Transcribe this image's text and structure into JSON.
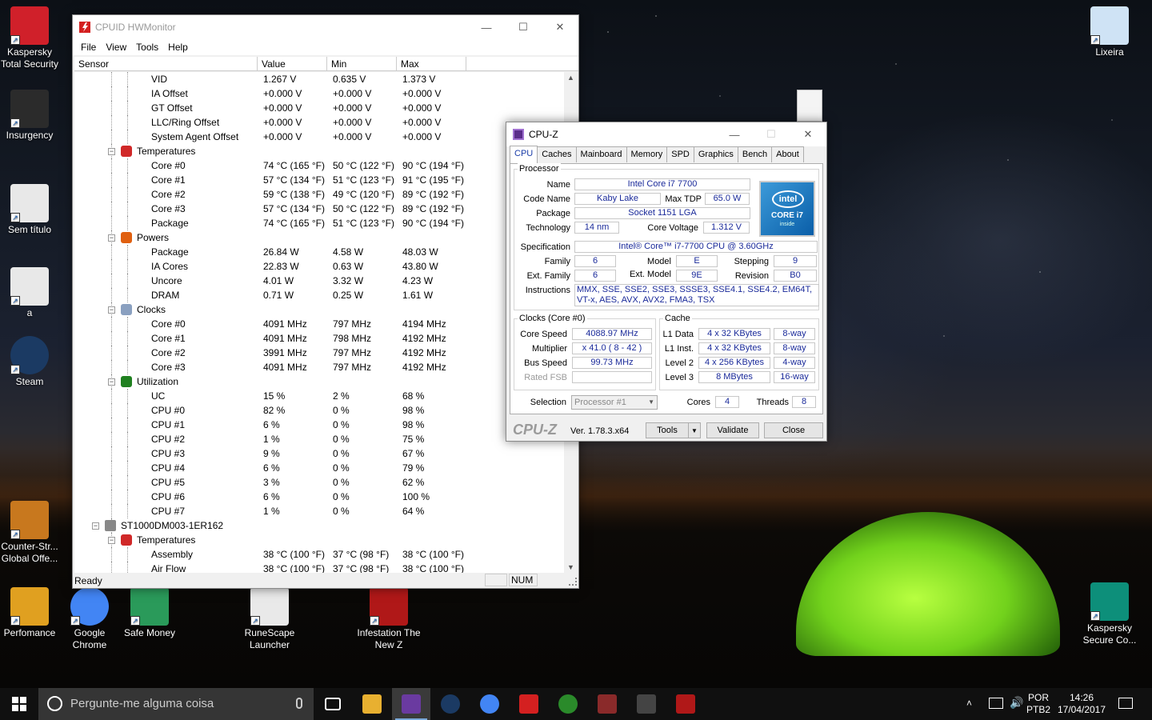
{
  "desktop": {
    "icons_left": [
      {
        "label": "Kaspersky Total Security",
        "icon": "kaspersky-icon"
      },
      {
        "label": "Insurgency",
        "icon": "insurgency-icon"
      },
      {
        "label": "Sem título",
        "icon": "image-file-icon"
      },
      {
        "label": "a",
        "icon": "image-file-icon"
      },
      {
        "label": "Steam",
        "icon": "steam-icon"
      },
      {
        "label": "Counter-Str... Global Offe...",
        "icon": "csgo-icon"
      }
    ],
    "icons_bottom": [
      {
        "label": "Perfomance",
        "icon": "folder-icon"
      },
      {
        "label": "Google Chrome",
        "icon": "chrome-icon"
      },
      {
        "label": "Safe Money",
        "icon": "safe-money-icon"
      },
      {
        "label": "RuneScape Launcher",
        "icon": "runescape-icon"
      },
      {
        "label": "Infestation The New Z",
        "icon": "infestation-icon"
      }
    ],
    "icons_right": [
      {
        "label": "Lixeira",
        "icon": "recycle-bin-icon"
      },
      {
        "label": "Kaspersky Secure Co...",
        "icon": "kaspersky-secure-icon"
      }
    ]
  },
  "hwmonitor": {
    "title": "CPUID HWMonitor",
    "menu": [
      "File",
      "View",
      "Tools",
      "Help"
    ],
    "columns": [
      "Sensor",
      "Value",
      "Min",
      "Max"
    ],
    "rows": [
      {
        "level": 3,
        "label": "VID",
        "value": "1.267 V",
        "min": "0.635 V",
        "max": "1.373 V"
      },
      {
        "level": 3,
        "label": "IA Offset",
        "value": "+0.000 V",
        "min": "+0.000 V",
        "max": "+0.000 V"
      },
      {
        "level": 3,
        "label": "GT Offset",
        "value": "+0.000 V",
        "min": "+0.000 V",
        "max": "+0.000 V"
      },
      {
        "level": 3,
        "label": "LLC/Ring Offset",
        "value": "+0.000 V",
        "min": "+0.000 V",
        "max": "+0.000 V"
      },
      {
        "level": 3,
        "label": "System Agent Offset",
        "value": "+0.000 V",
        "min": "+0.000 V",
        "max": "+0.000 V"
      },
      {
        "level": 2,
        "label": "Temperatures",
        "icon": "thermometer-icon",
        "value": "",
        "min": "",
        "max": ""
      },
      {
        "level": 3,
        "label": "Core #0",
        "value": "74 °C  (165 °F)",
        "min": "50 °C  (122 °F)",
        "max": "90 °C  (194 °F)"
      },
      {
        "level": 3,
        "label": "Core #1",
        "value": "57 °C  (134 °F)",
        "min": "51 °C  (123 °F)",
        "max": "91 °C  (195 °F)"
      },
      {
        "level": 3,
        "label": "Core #2",
        "value": "59 °C  (138 °F)",
        "min": "49 °C  (120 °F)",
        "max": "89 °C  (192 °F)"
      },
      {
        "level": 3,
        "label": "Core #3",
        "value": "57 °C  (134 °F)",
        "min": "50 °C  (122 °F)",
        "max": "89 °C  (192 °F)"
      },
      {
        "level": 3,
        "label": "Package",
        "value": "74 °C  (165 °F)",
        "min": "51 °C  (123 °F)",
        "max": "90 °C  (194 °F)"
      },
      {
        "level": 2,
        "label": "Powers",
        "icon": "power-icon",
        "value": "",
        "min": "",
        "max": ""
      },
      {
        "level": 3,
        "label": "Package",
        "value": "26.84 W",
        "min": "4.58 W",
        "max": "48.03 W"
      },
      {
        "level": 3,
        "label": "IA Cores",
        "value": "22.83 W",
        "min": "0.63 W",
        "max": "43.80 W"
      },
      {
        "level": 3,
        "label": "Uncore",
        "value": "4.01 W",
        "min": "3.32 W",
        "max": "4.23 W"
      },
      {
        "level": 3,
        "label": "DRAM",
        "value": "0.71 W",
        "min": "0.25 W",
        "max": "1.61 W"
      },
      {
        "level": 2,
        "label": "Clocks",
        "icon": "clock-icon",
        "value": "",
        "min": "",
        "max": ""
      },
      {
        "level": 3,
        "label": "Core #0",
        "value": "4091 MHz",
        "min": "797 MHz",
        "max": "4194 MHz"
      },
      {
        "level": 3,
        "label": "Core #1",
        "value": "4091 MHz",
        "min": "798 MHz",
        "max": "4192 MHz"
      },
      {
        "level": 3,
        "label": "Core #2",
        "value": "3991 MHz",
        "min": "797 MHz",
        "max": "4192 MHz"
      },
      {
        "level": 3,
        "label": "Core #3",
        "value": "4091 MHz",
        "min": "797 MHz",
        "max": "4192 MHz"
      },
      {
        "level": 2,
        "label": "Utilization",
        "icon": "utilization-icon",
        "value": "",
        "min": "",
        "max": ""
      },
      {
        "level": 3,
        "label": "UC",
        "value": "15 %",
        "min": "2 %",
        "max": "68 %"
      },
      {
        "level": 3,
        "label": "CPU #0",
        "value": "82 %",
        "min": "0 %",
        "max": "98 %"
      },
      {
        "level": 3,
        "label": "CPU #1",
        "value": "6 %",
        "min": "0 %",
        "max": "98 %"
      },
      {
        "level": 3,
        "label": "CPU #2",
        "value": "1 %",
        "min": "0 %",
        "max": "75 %"
      },
      {
        "level": 3,
        "label": "CPU #3",
        "value": "9 %",
        "min": "0 %",
        "max": "67 %"
      },
      {
        "level": 3,
        "label": "CPU #4",
        "value": "6 %",
        "min": "0 %",
        "max": "79 %"
      },
      {
        "level": 3,
        "label": "CPU #5",
        "value": "3 %",
        "min": "0 %",
        "max": "62 %"
      },
      {
        "level": 3,
        "label": "CPU #6",
        "value": "6 %",
        "min": "0 %",
        "max": "100 %"
      },
      {
        "level": 3,
        "label": "CPU #7",
        "value": "1 %",
        "min": "0 %",
        "max": "64 %"
      },
      {
        "level": 1,
        "label": "ST1000DM003-1ER162",
        "icon": "hard-drive-icon",
        "value": "",
        "min": "",
        "max": ""
      },
      {
        "level": 2,
        "label": "Temperatures",
        "icon": "thermometer-icon",
        "value": "",
        "min": "",
        "max": ""
      },
      {
        "level": 3,
        "label": "Assembly",
        "value": "38 °C  (100 °F)",
        "min": "37 °C  (98 °F)",
        "max": "38 °C  (100 °F)"
      },
      {
        "level": 3,
        "label": "Air Flow",
        "value": "38 °C  (100 °F)",
        "min": "37 °C  (98 °F)",
        "max": "38 °C  (100 °F)"
      }
    ],
    "status": {
      "left": "Ready",
      "num": "NUM"
    }
  },
  "cpuz": {
    "title": "CPU-Z",
    "tabs": [
      "CPU",
      "Caches",
      "Mainboard",
      "Memory",
      "SPD",
      "Graphics",
      "Bench",
      "About"
    ],
    "active_tab": "CPU",
    "processor": {
      "group": "Processor",
      "name_label": "Name",
      "name": "Intel Core i7 7700",
      "codename_label": "Code Name",
      "codename": "Kaby Lake",
      "maxtdp_label": "Max TDP",
      "maxtdp": "65.0 W",
      "package_label": "Package",
      "package": "Socket 1151 LGA",
      "technology_label": "Technology",
      "technology": "14 nm",
      "corevoltage_label": "Core Voltage",
      "corevoltage": "1.312 V",
      "spec_label": "Specification",
      "spec": "Intel® Core™ i7-7700 CPU @ 3.60GHz",
      "family_label": "Family",
      "family": "6",
      "model_label": "Model",
      "model": "E",
      "stepping_label": "Stepping",
      "stepping": "9",
      "extfamily_label": "Ext. Family",
      "extfamily": "6",
      "extmodel_label": "Ext. Model",
      "extmodel": "9E",
      "revision_label": "Revision",
      "revision": "B0",
      "instructions_label": "Instructions",
      "instructions": "MMX, SSE, SSE2, SSE3, SSSE3, SSE4.1, SSE4.2, EM64T, VT-x, AES, AVX, AVX2, FMA3, TSX",
      "logo_brand": "intel",
      "logo_line": "CORE i7",
      "logo_sub": "inside"
    },
    "clocks": {
      "group": "Clocks (Core #0)",
      "corespeed_label": "Core Speed",
      "corespeed": "4088.97 MHz",
      "multiplier_label": "Multiplier",
      "multiplier": "x 41.0 ( 8 - 42 )",
      "busspeed_label": "Bus Speed",
      "busspeed": "99.73 MHz",
      "ratedfsb_label": "Rated FSB",
      "ratedfsb": ""
    },
    "cache": {
      "group": "Cache",
      "l1d_label": "L1 Data",
      "l1d": "4 x 32 KBytes",
      "l1d_way": "8-way",
      "l1i_label": "L1 Inst.",
      "l1i": "4 x 32 KBytes",
      "l1i_way": "8-way",
      "l2_label": "Level 2",
      "l2": "4 x 256 KBytes",
      "l2_way": "4-way",
      "l3_label": "Level 3",
      "l3": "8 MBytes",
      "l3_way": "16-way"
    },
    "selection": {
      "selection_label": "Selection",
      "selection": "Processor #1",
      "cores_label": "Cores",
      "cores": "4",
      "threads_label": "Threads",
      "threads": "8"
    },
    "footer": {
      "brand": "CPU-Z",
      "version": "Ver. 1.78.3.x64",
      "tools": "Tools",
      "validate": "Validate",
      "close": "Close"
    }
  },
  "taskbar": {
    "search_placeholder": "Pergunte-me alguma coisa",
    "apps": [
      "task-view-icon",
      "file-explorer-icon",
      "cpuz-taskbar-icon",
      "steam-icon",
      "chrome-icon",
      "hwmonitor-icon",
      "xbox-icon",
      "app-icon",
      "gpu-icon",
      "infestation-icon"
    ],
    "language_top": "POR",
    "language_bottom": "PTB2",
    "time": "14:26",
    "date": "17/04/2017"
  }
}
